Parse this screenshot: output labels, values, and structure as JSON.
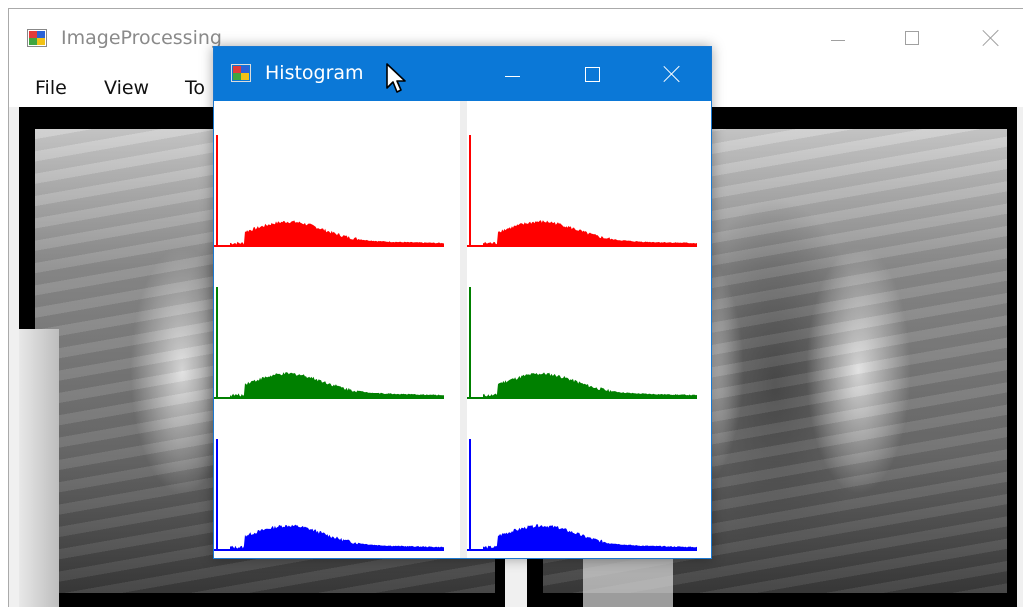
{
  "main_window": {
    "title": "ImageProcessing",
    "menu": [
      "File",
      "View",
      "To"
    ]
  },
  "histogram_window": {
    "title": "Histogram"
  },
  "colors": {
    "red": "#ff0000",
    "green": "#008000",
    "blue": "#0000ff",
    "titlebar_active": "#0b78d7"
  },
  "icons": {
    "app": "windows-forms-app-icon",
    "minimize": "minimize-icon",
    "maximize": "maximize-icon",
    "close": "close-icon",
    "cursor": "mouse-pointer-icon"
  }
}
